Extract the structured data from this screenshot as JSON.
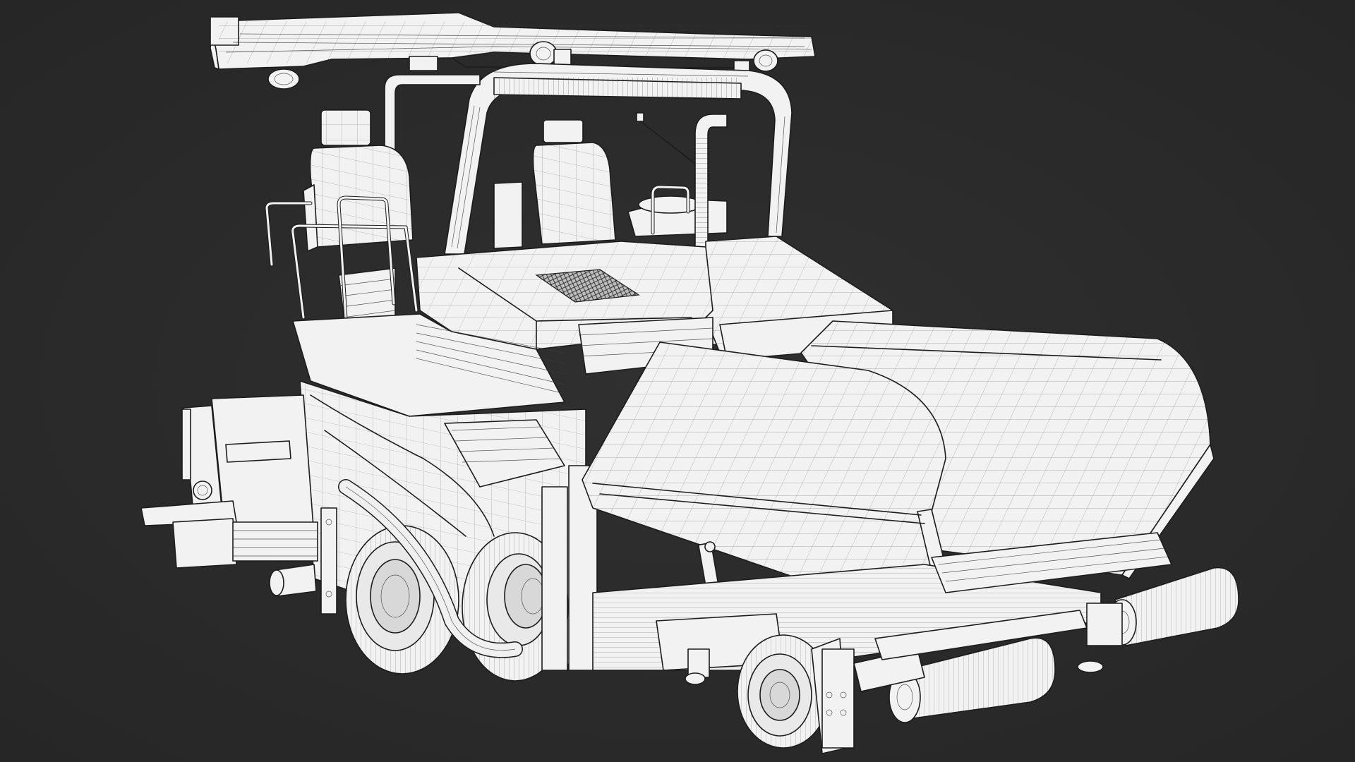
{
  "viewport": {
    "background_color": "#2b2b2b",
    "model_fill_color": "#f2f2f2",
    "wire_color": "#1c1c1c",
    "render_mode": "wireframe-on-shaded"
  },
  "model": {
    "subject_icon": "asphalt-paver-wireframe-model",
    "parts": [
      "canopy-roof-icon",
      "roll-bar-icon",
      "operator-seat-left-icon",
      "operator-seat-right-icon",
      "engine-hood-icon",
      "engine-grille-icon",
      "exhaust-pipe-icon",
      "hopper-wing-left-icon",
      "hopper-wing-right-icon",
      "rear-wheel-icon",
      "front-wheel-icon",
      "push-roller-left-icon",
      "push-roller-right-icon",
      "screed-platform-icon",
      "handrail-icon"
    ]
  }
}
